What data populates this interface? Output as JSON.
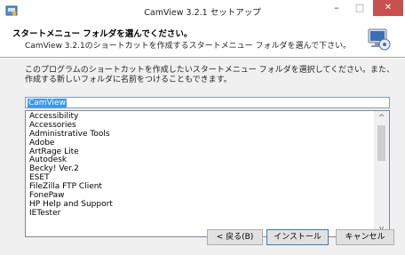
{
  "window": {
    "title": "CamView 3.2.1 セットアップ",
    "controls": {
      "minimize": "–",
      "maximize": "□",
      "close": "✕"
    }
  },
  "header": {
    "title": "スタートメニュー フォルダを選んでください。",
    "subtitle": "CamView 3.2.1のショートカットを作成するスタートメニュー フォルダを選んで下さい。"
  },
  "description": "このプログラムのショートカットを作成したいスタートメニュー フォルダを選択してください。また、作成する新しいフォルダに名前をつけることもできます。",
  "folder_input": {
    "value": "CamView"
  },
  "folder_list": {
    "items": [
      "Accessibility",
      "Accessories",
      "Administrative Tools",
      "Adobe",
      "ArtRage Lite",
      "Autodesk",
      "Becky! Ver.2",
      "ESET",
      "FileZilla FTP Client",
      "FonePaw",
      "HP Help and Support",
      "IETester"
    ],
    "scroll_up": "^",
    "scroll_down": "v"
  },
  "buttons": {
    "back": "< 戻る(B)",
    "install": "インストール",
    "cancel": "キャンセル"
  }
}
